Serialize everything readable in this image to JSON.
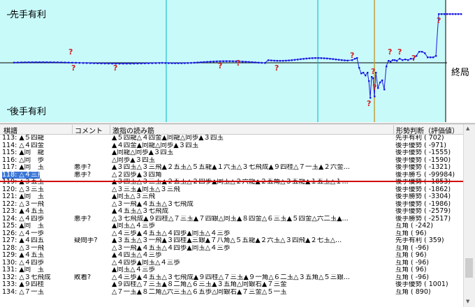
{
  "graph": {
    "label_top": "先手有利",
    "label_bottom": "後手有利",
    "label_end": "終局",
    "colors": {
      "background": "#c8fafa",
      "line": "#1a1ae0",
      "axis": "#000000",
      "question": "#d02020",
      "cursor": "#a08020",
      "vline": "#00b4c8"
    }
  },
  "columns": [
    "棋譜",
    "コメント",
    "激指の読み筋",
    "形勢判断（評価値）"
  ],
  "rows": [
    {
      "move": "113: ▲５四龍",
      "comment": "",
      "line": "▲５四龍△４四金▲同龍△同歩▲３四玉",
      "eval": "先手有利 (   702)"
    },
    {
      "move": "114: △４四金",
      "comment": "",
      "line": "▲４四金▲同龍△同歩▲３四玉",
      "eval": "後手優勢 (  -971)"
    },
    {
      "move": "115: ▲同　龍",
      "comment": "",
      "line": "▲同龍△同歩▲３四玉",
      "eval": "後手優勢 ( -1555)"
    },
    {
      "move": "116: △同　歩",
      "comment": "",
      "line": "△同歩▲３四玉",
      "eval": "後手優勢 ( -1590)"
    },
    {
      "move": "117: ▲同　玉",
      "comment": "悪手?",
      "line": "▲３四玉△３三飛▲２五玉△５五龍▲１六玉△３七飛成▲９四桂△７一玉▲２六金...",
      "eval": "後手優勢 ( -1321)"
    },
    {
      "move": "118: △４三飛",
      "comment": "悪手?",
      "line": "△２四歩▲３四角",
      "eval": "後手勝ち ( -99984)"
    },
    {
      "move": "119: ▲３五玉",
      "comment": "",
      "line": "▲３四玉△３三玉▲２五玉△２四歩▲同玉△２六龍▲２五角△３五龍▲１五玉△１...",
      "eval": "後手優勢 ( -1853)"
    },
    {
      "move": "120: △３三玉",
      "comment": "",
      "line": "△３三玉▲同玉△３三飛",
      "eval": "後手優勢 ( -1862)"
    },
    {
      "move": "121: ▲同　玉",
      "comment": "",
      "line": "▲同玉△３三飛",
      "eval": "後手勝勢 ( -3304)"
    },
    {
      "move": "122: △３一飛",
      "comment": "",
      "line": "△３一飛▲４五玉△３七飛成",
      "eval": "後手優勢 ( -1986)"
    },
    {
      "move": "123: ▲４五玉",
      "comment": "",
      "line": "▲４五玉△３七飛成",
      "eval": "後手優勢 ( -2579)"
    },
    {
      "move": "124: △４四歩",
      "comment": "悪手?",
      "line": "△３七飛成▲９四桂△７三玉▲７四銀△同玉▲８四金△６三玉▲５四金△六二玉▲...",
      "eval": "後手勝勢 ( -2517)"
    },
    {
      "move": "125: ▲同　玉",
      "comment": "",
      "line": "▲同玉△４三歩",
      "eval": "互角 (  -242)"
    },
    {
      "move": "126: △４一歩",
      "comment": "",
      "line": "△４三歩▲４五玉△４四歩▲同玉△４三歩",
      "eval": "互角 (    96)"
    },
    {
      "move": "127: ▲４四五",
      "comment": "疑問手?",
      "line": "▲３五玉△３一飛▲３四桂▲三銀▲７八角△５五龍▲２六玉△３四飛▲２七玉△...",
      "eval": "先手有利 (   359)"
    },
    {
      "move": "128: △３一飛",
      "comment": "",
      "line": "△３一飛▲４五玉△４四歩▲同玉△４三歩",
      "eval": "互角 (   -96)"
    },
    {
      "move": "129: ▲４五玉",
      "comment": "",
      "line": "▲４四玉△４三歩",
      "eval": "互角 (    96)"
    },
    {
      "move": "130: △４四歩",
      "comment": "",
      "line": "△４四歩▲同玉△４三歩",
      "eval": "互角 (   -96)"
    },
    {
      "move": "131: ▲同　玉",
      "comment": "",
      "line": "▲同玉△４三歩",
      "eval": "互角 (    96)"
    },
    {
      "move": "132: △３七飛成",
      "comment": "敗着?",
      "line": "△４三歩▲４五玉△３七飛成▲９四桂△７三玉▲９一角△６二玉△３五角△５三銀...",
      "eval": "互角 (   -96)"
    },
    {
      "move": "133: ▲９四桂",
      "comment": "",
      "line": "▲９四桂△７三玉▲８二角△６三玉▲３五角△同銀右▲７三金",
      "eval": "後手優勢 ( 1001)"
    },
    {
      "move": "134: △７一玉",
      "comment": "",
      "line": "△７一玉▲８二角△六三玉△６五歩△同銀右▲７三金△５一玉",
      "eval": "互角 (   890)"
    }
  ]
}
